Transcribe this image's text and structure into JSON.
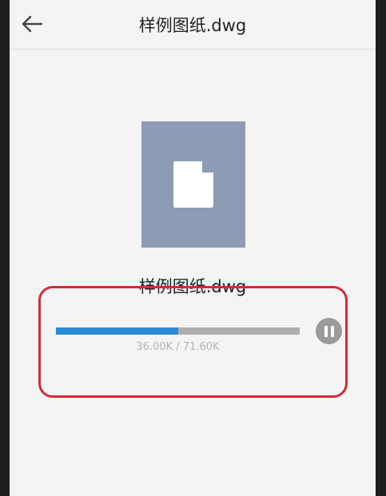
{
  "header": {
    "title": "样例图纸.dwg",
    "back_icon": "arrow-left-icon"
  },
  "file": {
    "name": "样例图纸.dwg",
    "icon": "document-icon",
    "thumb_color": "#8e9bb4"
  },
  "download": {
    "progress": 0.5028,
    "size_text": "36.00K / 71.60K",
    "pause_icon": "pause-icon",
    "progress_color": "#2b8ad6"
  },
  "annotation": {
    "highlight_color": "#d42a3a"
  }
}
